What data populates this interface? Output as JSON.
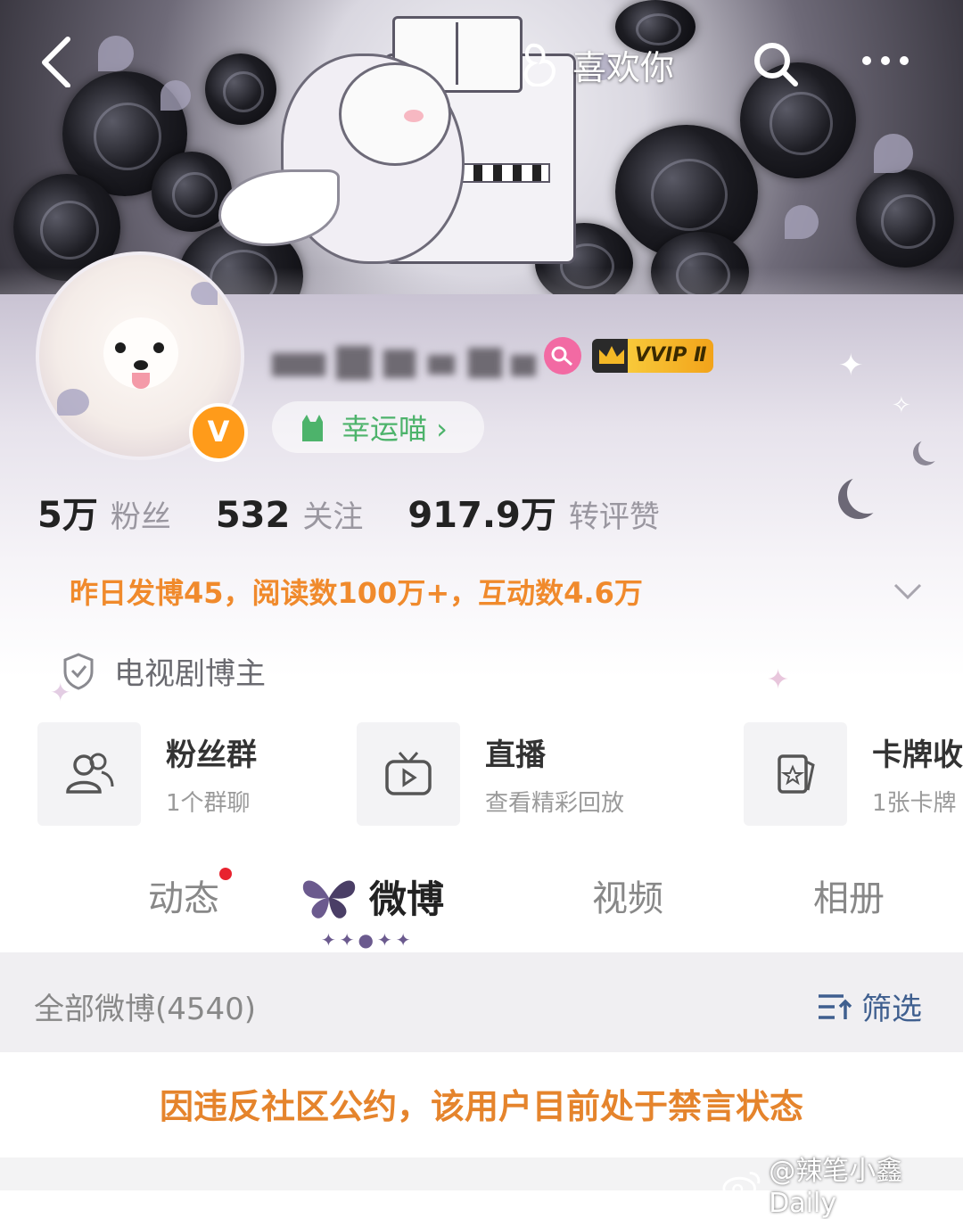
{
  "nav": {
    "back_icon": "chevron-left-icon",
    "title": "喜欢你",
    "search_icon": "search-icon",
    "more_icon": "more-dots-icon"
  },
  "profile": {
    "vip_label": "VVIP Ⅱ",
    "lucky_label": "幸运喵 ›",
    "verified_symbol": "V"
  },
  "stats": [
    {
      "value": "5万",
      "label": "粉丝"
    },
    {
      "value": "532",
      "label": "关注"
    },
    {
      "value": "917.9万",
      "label": "转评赞"
    }
  ],
  "activity_summary": "昨日发博45，阅读数100万+，互动数4.6万",
  "tag": "电视剧博主",
  "cards": [
    {
      "title": "粉丝群",
      "sub": "1个群聊",
      "icon": "group-icon"
    },
    {
      "title": "直播",
      "sub": "查看精彩回放",
      "icon": "tv-icon"
    },
    {
      "title": "卡牌收",
      "sub": "1张卡牌",
      "icon": "card-icon"
    }
  ],
  "tabs": [
    "动态",
    "微博",
    "视频",
    "相册"
  ],
  "feed": {
    "all_label": "全部微博(4540)",
    "filter_label": "筛选"
  },
  "notice": "因违反社区公约，该用户目前处于禁言状态",
  "watermark": "@辣笔小鑫Daily",
  "colors": {
    "accent_orange": "#f08a2c",
    "notice_orange": "#e5842c",
    "vip_gold": "#f4b826",
    "lucky_green": "#4db36b"
  }
}
